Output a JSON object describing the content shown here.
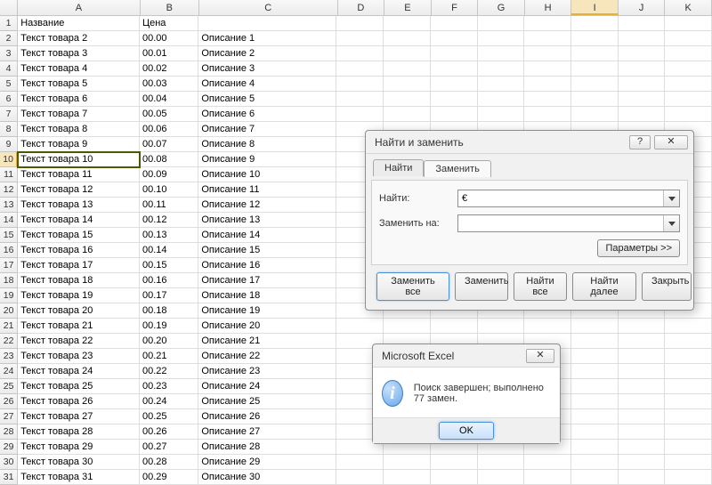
{
  "columns": [
    "A",
    "B",
    "C",
    "D",
    "E",
    "F",
    "G",
    "H",
    "I",
    "J",
    "K"
  ],
  "column_widths": {
    "A": 149,
    "B": 72,
    "C": 169,
    "D": 57,
    "E": 57,
    "F": 57,
    "G": 57,
    "H": 57,
    "I": 57,
    "J": 57,
    "K": 57
  },
  "selected_cell": {
    "row": 10,
    "col": "A"
  },
  "highlighted_column_header": "I",
  "headers": {
    "A": "Название",
    "B": "Цена",
    "C": ""
  },
  "rows": [
    {
      "n": 1,
      "A": "Название",
      "B": "Цена",
      "C": ""
    },
    {
      "n": 2,
      "A": "Текст товара 2",
      "B": "00.00",
      "C": "Описание 1"
    },
    {
      "n": 3,
      "A": "Текст товара 3",
      "B": "00.01",
      "C": "Описание 2"
    },
    {
      "n": 4,
      "A": "Текст товара 4",
      "B": "00.02",
      "C": "Описание 3"
    },
    {
      "n": 5,
      "A": "Текст товара 5",
      "B": "00.03",
      "C": "Описание 4"
    },
    {
      "n": 6,
      "A": "Текст товара 6",
      "B": "00.04",
      "C": "Описание 5"
    },
    {
      "n": 7,
      "A": "Текст товара 7",
      "B": "00.05",
      "C": "Описание 6"
    },
    {
      "n": 8,
      "A": "Текст товара 8",
      "B": "00.06",
      "C": "Описание 7"
    },
    {
      "n": 9,
      "A": "Текст товара 9",
      "B": "00.07",
      "C": "Описание 8"
    },
    {
      "n": 10,
      "A": "Текст товара 10",
      "B": "00.08",
      "C": "Описание 9"
    },
    {
      "n": 11,
      "A": "Текст товара 11",
      "B": "00.09",
      "C": "Описание 10"
    },
    {
      "n": 12,
      "A": "Текст товара 12",
      "B": "00.10",
      "C": "Описание 11"
    },
    {
      "n": 13,
      "A": "Текст товара 13",
      "B": "00.11",
      "C": "Описание 12"
    },
    {
      "n": 14,
      "A": "Текст товара 14",
      "B": "00.12",
      "C": "Описание 13"
    },
    {
      "n": 15,
      "A": "Текст товара 15",
      "B": "00.13",
      "C": "Описание 14"
    },
    {
      "n": 16,
      "A": "Текст товара 16",
      "B": "00.14",
      "C": "Описание 15"
    },
    {
      "n": 17,
      "A": "Текст товара 17",
      "B": "00.15",
      "C": "Описание 16"
    },
    {
      "n": 18,
      "A": "Текст товара 18",
      "B": "00.16",
      "C": "Описание 17"
    },
    {
      "n": 19,
      "A": "Текст товара 19",
      "B": "00.17",
      "C": "Описание 18"
    },
    {
      "n": 20,
      "A": "Текст товара 20",
      "B": "00.18",
      "C": "Описание 19"
    },
    {
      "n": 21,
      "A": "Текст товара 21",
      "B": "00.19",
      "C": "Описание 20"
    },
    {
      "n": 22,
      "A": "Текст товара 22",
      "B": "00.20",
      "C": "Описание 21"
    },
    {
      "n": 23,
      "A": "Текст товара 23",
      "B": "00.21",
      "C": "Описание 22"
    },
    {
      "n": 24,
      "A": "Текст товара 24",
      "B": "00.22",
      "C": "Описание 23"
    },
    {
      "n": 25,
      "A": "Текст товара 25",
      "B": "00.23",
      "C": "Описание 24"
    },
    {
      "n": 26,
      "A": "Текст товара 26",
      "B": "00.24",
      "C": "Описание 25"
    },
    {
      "n": 27,
      "A": "Текст товара 27",
      "B": "00.25",
      "C": "Описание 26"
    },
    {
      "n": 28,
      "A": "Текст товара 28",
      "B": "00.26",
      "C": "Описание 27"
    },
    {
      "n": 29,
      "A": "Текст товара 29",
      "B": "00.27",
      "C": "Описание 28"
    },
    {
      "n": 30,
      "A": "Текст товара 30",
      "B": "00.28",
      "C": "Описание 29"
    },
    {
      "n": 31,
      "A": "Текст товара 31",
      "B": "00.29",
      "C": "Описание 30"
    }
  ],
  "find_replace": {
    "title": "Найти и заменить",
    "help_symbol": "?",
    "close_symbol": "✕",
    "tabs": {
      "find": "Найти",
      "replace": "Заменить"
    },
    "active_tab": "replace",
    "find_label": "Найти:",
    "find_value": "€",
    "replace_label": "Заменить на:",
    "replace_value": "",
    "params_button": "Параметры >>",
    "buttons": {
      "replace_all": "Заменить все",
      "replace": "Заменить",
      "find_all": "Найти все",
      "find_next": "Найти далее",
      "close": "Закрыть"
    }
  },
  "msgbox": {
    "title": "Microsoft Excel",
    "close_symbol": "✕",
    "icon_glyph": "i",
    "text": "Поиск завершен; выполнено 77 замен.",
    "ok": "OK"
  }
}
